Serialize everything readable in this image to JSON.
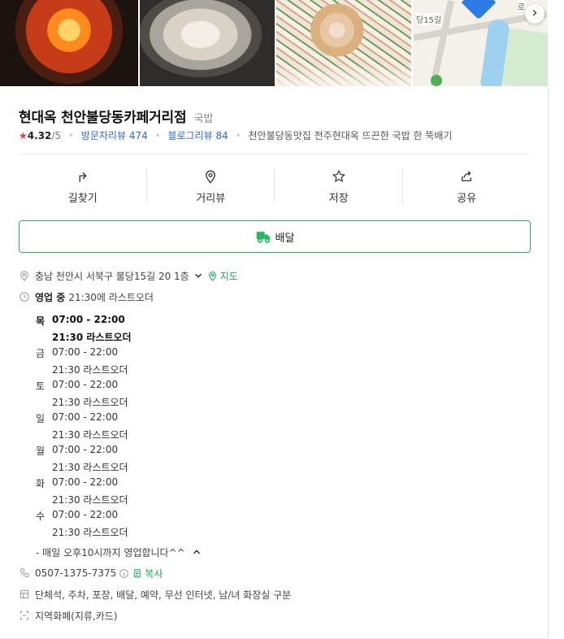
{
  "map": {
    "road_label_1": "당15길",
    "road_label_2": "로",
    "next_icon": "chevron-right-icon"
  },
  "place": {
    "name": "현대옥 천안불당동카페거리점",
    "category": "국밥",
    "rating": "4.32",
    "rating_max": "/5",
    "visitor_review_label": "방문자리뷰",
    "visitor_review_count": "474",
    "blog_review_label": "블로그리뷰",
    "blog_review_count": "84",
    "description": "천안불당동맛집 전주현대옥 뜨끈한 국밥 한 뚝배기"
  },
  "actions": [
    {
      "label": "길찾기",
      "icon": "directions-icon"
    },
    {
      "label": "거리뷰",
      "icon": "street-view-icon"
    },
    {
      "label": "저장",
      "icon": "star-icon"
    },
    {
      "label": "공유",
      "icon": "share-icon"
    }
  ],
  "delivery": {
    "label": "배달",
    "icon": "delivery-truck-icon"
  },
  "address": {
    "text": "충남 천안시 서북구 불당15길 20 1층",
    "map_link": "지도"
  },
  "open": {
    "status": "영업 중",
    "last_order_note": "21:30에 라스트오더"
  },
  "hours": [
    {
      "day": "목",
      "time": "07:00 - 22:00",
      "last_order": "21:30 라스트오더"
    },
    {
      "day": "금",
      "time": "07:00 - 22:00",
      "last_order": "21:30 라스트오더"
    },
    {
      "day": "토",
      "time": "07:00 - 22:00",
      "last_order": "21:30 라스트오더"
    },
    {
      "day": "일",
      "time": "07:00 - 22:00",
      "last_order": "21:30 라스트오더"
    },
    {
      "day": "월",
      "time": "07:00 - 22:00",
      "last_order": "21:30 라스트오더"
    },
    {
      "day": "화",
      "time": "07:00 - 22:00",
      "last_order": "21:30 라스트오더"
    },
    {
      "day": "수",
      "time": "07:00 - 22:00",
      "last_order": "21:30 라스트오더"
    }
  ],
  "hours_note": "- 매일 오후10시까지 영업합니다^^",
  "phone": {
    "number": "0507-1375-7375",
    "copy_label": "복사"
  },
  "amenities": "단체석, 주차, 포장, 배달, 예약, 무선 인터넷, 남/녀 화장실 구분",
  "payment": "지역화폐(지류,카드)",
  "colors": {
    "green": "#25b85f",
    "link_blue": "#2d66d8",
    "star_red": "#f13c3c"
  }
}
